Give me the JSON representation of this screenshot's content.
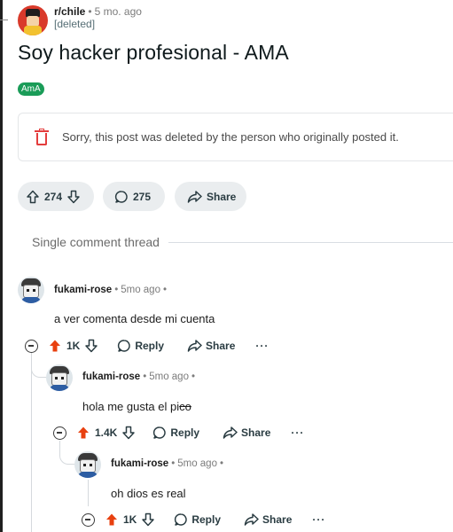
{
  "post": {
    "subreddit": "r/chile",
    "age": "5 mo. ago",
    "author": "[deleted]",
    "title": "Soy hacker profesional - AMA",
    "flair": "AmA",
    "deleted_message": "Sorry, this post was deleted by the person who originally posted it."
  },
  "actions": {
    "votes": "274",
    "comments": "275",
    "share": "Share"
  },
  "thread_label": "Single comment thread",
  "comments": [
    {
      "user": "fukami-rose",
      "age": "5mo ago",
      "text": "a ver comenta desde mi cuenta",
      "votes": "1K",
      "reply": "Reply",
      "share": "Share",
      "more": "···"
    },
    {
      "user": "fukami-rose",
      "age": "5mo ago",
      "text": "hola me gusta el pi",
      "text_struck": "co",
      "votes": "1.4K",
      "reply": "Reply",
      "share": "Share",
      "more": "···"
    },
    {
      "user": "fukami-rose",
      "age": "5mo ago",
      "text": "oh dios es real",
      "votes": "1K",
      "reply": "Reply",
      "share": "Share",
      "more": "···"
    }
  ],
  "icons": {
    "flair_color": "#1a9c58",
    "delete_color": "#e43d3d",
    "upvote_active_color": "#e8400f",
    "subreddit_avatar": "subreddit-avatar-icon",
    "user_avatar": "user-avatar-icon"
  }
}
